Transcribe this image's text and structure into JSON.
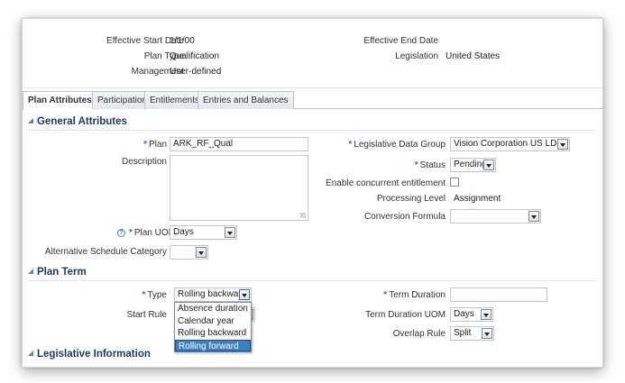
{
  "header": {
    "effective_start_date": {
      "label": "Effective Start Date",
      "value": "1/1/00"
    },
    "plan_type": {
      "label": "Plan Type",
      "value": "Qualification"
    },
    "management": {
      "label": "Management",
      "value": "User-defined"
    },
    "effective_end_date": {
      "label": "Effective End Date",
      "value": ""
    },
    "legislation": {
      "label": "Legislation",
      "value": "United States"
    }
  },
  "tabs": [
    {
      "label": "Plan Attributes",
      "active": true
    },
    {
      "label": "Participation",
      "active": false
    },
    {
      "label": "Entitlements",
      "active": false
    },
    {
      "label": "Entries and Balances",
      "active": false
    }
  ],
  "general": {
    "title": "General Attributes",
    "plan": {
      "label": "Plan",
      "required": "*",
      "value": "ARK_RF_Qual"
    },
    "description": {
      "label": "Description",
      "value": ""
    },
    "plan_uom": {
      "label": "Plan UOM",
      "required": "*",
      "value": "Days",
      "help_icon": "?"
    },
    "alt_schedule": {
      "label": "Alternative Schedule Category",
      "value": ""
    },
    "legislative_data_group": {
      "label": "Legislative Data Group",
      "required": "*",
      "value": "Vision Corporation US LDG"
    },
    "status": {
      "label": "Status",
      "required": "*",
      "value": "Pending"
    },
    "concurrent": {
      "label": "Enable concurrent entitlement",
      "checked": false
    },
    "processing_level": {
      "label": "Processing Level",
      "value": "Assignment"
    },
    "conversion_formula": {
      "label": "Conversion Formula",
      "value": ""
    }
  },
  "plan_term": {
    "title": "Plan Term",
    "type": {
      "label": "Type",
      "required": "*",
      "value": "Rolling backward",
      "options": [
        "Absence duration",
        "Calendar year",
        "Rolling backward",
        "Rolling forward"
      ],
      "highlighted": "Rolling forward"
    },
    "start_rule": {
      "label": "Start Rule"
    },
    "term_duration": {
      "label": "Term Duration",
      "required": "*",
      "value": ""
    },
    "term_duration_uom": {
      "label": "Term Duration UOM",
      "value": "Days"
    },
    "overlap_rule": {
      "label": "Overlap Rule",
      "value": "Split"
    }
  },
  "legislative": {
    "title": "Legislative Information"
  }
}
